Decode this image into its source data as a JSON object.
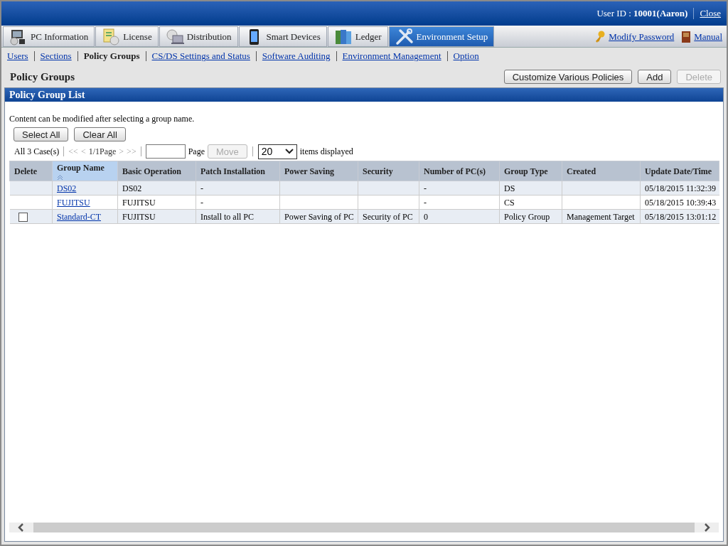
{
  "header": {
    "user_label": "User ID : ",
    "user_value": "10001(Aaron)",
    "close": "Close"
  },
  "tabs": [
    {
      "label": "PC Information",
      "selected": false
    },
    {
      "label": "License",
      "selected": false
    },
    {
      "label": "Distribution",
      "selected": false
    },
    {
      "label": "Smart Devices",
      "selected": false
    },
    {
      "label": "Ledger",
      "selected": false
    },
    {
      "label": "Environment Setup",
      "selected": true
    }
  ],
  "tools": {
    "modify_password": "Modify Password",
    "manual": "Manual"
  },
  "subnav": [
    {
      "label": "Users",
      "selected": false
    },
    {
      "label": "Sections",
      "selected": false
    },
    {
      "label": "Policy Groups",
      "selected": true
    },
    {
      "label": "CS/DS Settings and Status",
      "selected": false
    },
    {
      "label": "Software Auditing",
      "selected": false
    },
    {
      "label": "Environment Management",
      "selected": false
    },
    {
      "label": "Option",
      "selected": false
    }
  ],
  "page_title": "Policy Groups",
  "actions": [
    {
      "label": "Customize Various Policies",
      "disabled": false
    },
    {
      "label": "Add",
      "disabled": false
    },
    {
      "label": "Delete",
      "disabled": true
    }
  ],
  "section_title": "Policy Group List",
  "hint": "Content can be modified after selecting a group name.",
  "select_buttons": [
    "Select All",
    "Clear All"
  ],
  "pager": {
    "count": "All 3 Case(s)",
    "first": "<<",
    "prev": "<",
    "page": "1/1Page",
    "next": ">",
    "last": ">>",
    "page_label": "Page",
    "move": {
      "label": "Move",
      "disabled": true
    },
    "per_page": "20",
    "per_page_label": "items displayed"
  },
  "table": {
    "columns": [
      {
        "label": "Delete",
        "sorted": false
      },
      {
        "label": "Group Name",
        "sorted": true
      },
      {
        "label": "Basic Operation",
        "sorted": false
      },
      {
        "label": "Patch Installation",
        "sorted": false
      },
      {
        "label": "Power Saving",
        "sorted": false
      },
      {
        "label": "Security",
        "sorted": false
      },
      {
        "label": "Number of PC(s)",
        "sorted": false
      },
      {
        "label": "Group Type",
        "sorted": false
      },
      {
        "label": "Created",
        "sorted": false
      },
      {
        "label": "Update Date/Time",
        "sorted": false
      }
    ],
    "rows": [
      {
        "cells": [
          "",
          "DS02",
          "DS02",
          "-",
          "",
          "",
          "-",
          "DS",
          "",
          "05/18/2015 11:32:39"
        ]
      },
      {
        "cells": [
          "",
          "FUJITSU",
          "FUJITSU",
          "-",
          "",
          "",
          "-",
          "CS",
          "",
          "05/18/2015 10:39:43"
        ]
      },
      {
        "delete_checkbox": {
          "checked": false
        },
        "cells": [
          "",
          "Standard-CT",
          "FUJITSU",
          "Install to all PC",
          "Power Saving of PC",
          "Security of PC",
          "0",
          "Policy Group",
          "Management Target",
          "05/18/2015 13:01:12"
        ]
      }
    ]
  }
}
